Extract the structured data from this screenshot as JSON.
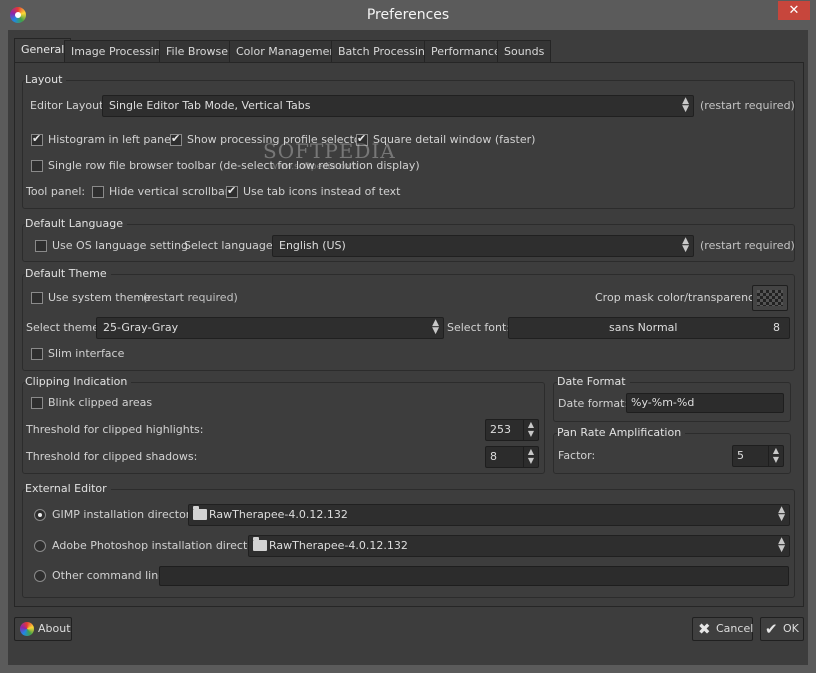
{
  "window": {
    "title": "Preferences",
    "close_glyph": "✕"
  },
  "tabs": [
    {
      "label": "General"
    },
    {
      "label": "Image Processing"
    },
    {
      "label": "File Browser"
    },
    {
      "label": "Color Management"
    },
    {
      "label": "Batch Processing"
    },
    {
      "label": "Performance"
    },
    {
      "label": "Sounds"
    }
  ],
  "watermark": {
    "text": "SOFTPEDIA",
    "sub": "www.softpedia.com"
  },
  "layout": {
    "title": "Layout",
    "editor_layout_label": "Editor Layout:",
    "editor_layout_value": "Single Editor Tab Mode, Vertical Tabs",
    "restart_note": "(restart required)",
    "histogram_left": "Histogram in left panel",
    "show_profile_selector": "Show processing profile selector",
    "square_detail": "Square detail window (faster)",
    "single_row_toolbar": "Single row file browser toolbar (de-select for low resolution display)",
    "tool_panel_label": "Tool panel:",
    "hide_scrollbar": "Hide vertical scrollbar",
    "tab_icons": "Use tab icons instead of text"
  },
  "language": {
    "title": "Default Language",
    "use_os": "Use OS language setting",
    "select_label": "Select language:",
    "value": "English (US)",
    "restart_note": "(restart required)"
  },
  "theme": {
    "title": "Default Theme",
    "use_system": "Use system theme",
    "restart_note": "(restart required)",
    "crop_mask_label": "Crop mask color/transparency:",
    "select_theme_label": "Select theme:",
    "theme_value": "25-Gray-Gray",
    "select_font_label": "Select font:",
    "font_value": "sans Normal",
    "font_size": "8",
    "slim": "Slim interface"
  },
  "clipping": {
    "title": "Clipping Indication",
    "blink": "Blink clipped areas",
    "highlights_label": "Threshold for clipped highlights:",
    "highlights_value": "253",
    "shadows_label": "Threshold for clipped shadows:",
    "shadows_value": "8"
  },
  "date_format": {
    "title": "Date Format",
    "label": "Date format:",
    "value": "%y-%m-%d"
  },
  "pan_rate": {
    "title": "Pan Rate Amplification",
    "label": "Factor:",
    "value": "5"
  },
  "external_editor": {
    "title": "External Editor",
    "gimp_label": "GIMP installation directory:",
    "gimp_value": "RawTherapee-4.0.12.132",
    "photoshop_label": "Adobe Photoshop installation directory:",
    "photoshop_value": "RawTherapee-4.0.12.132",
    "other_label": "Other command line:",
    "other_value": ""
  },
  "buttons": {
    "about": "About",
    "cancel": "Cancel",
    "ok": "OK"
  },
  "icons": {
    "app": "rawtherapee-icon",
    "close": "close-icon",
    "folder": "folder-icon",
    "cancel": "x-icon",
    "ok": "check-icon"
  }
}
